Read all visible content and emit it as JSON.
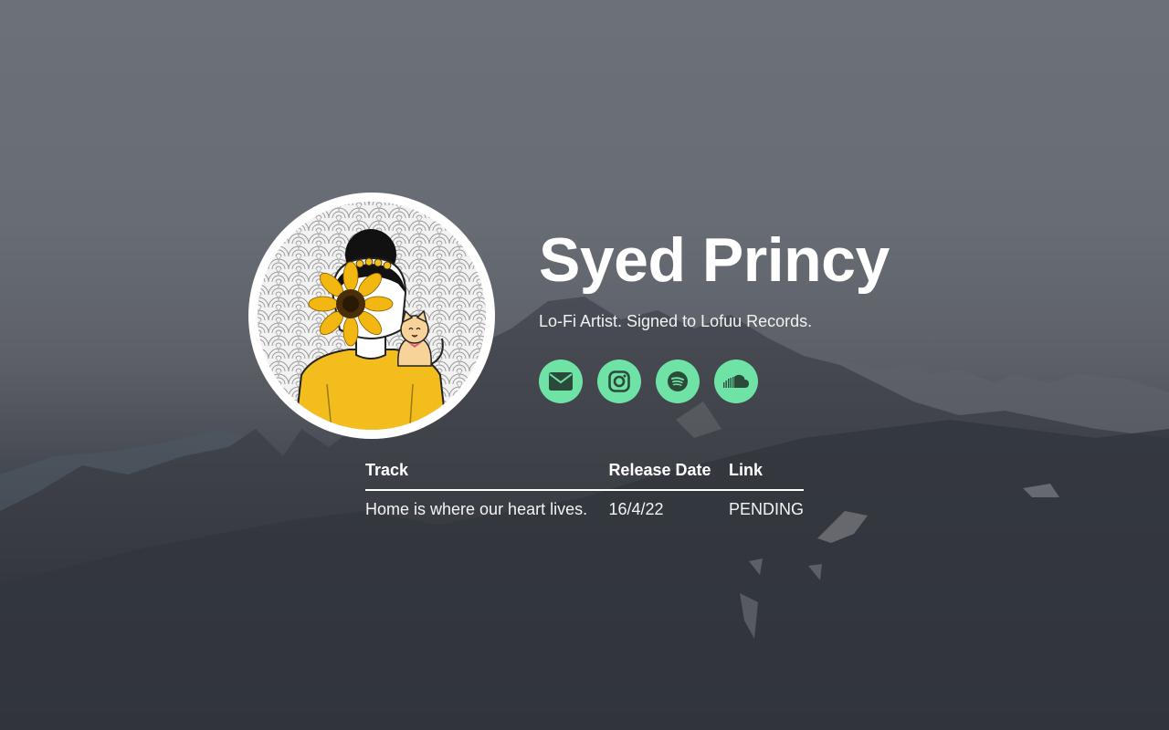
{
  "profile": {
    "name": "Syed Princy",
    "tagline": "Lo-Fi Artist. Signed to Lofuu Records.",
    "avatar_icon": "artist-avatar-sunflower-cat"
  },
  "socials": [
    {
      "icon": "envelope-icon",
      "label": "Email"
    },
    {
      "icon": "instagram-icon",
      "label": "Instagram"
    },
    {
      "icon": "spotify-icon",
      "label": "Spotify"
    },
    {
      "icon": "soundcloud-icon",
      "label": "SoundCloud"
    }
  ],
  "table": {
    "headers": {
      "track": "Track",
      "release_date": "Release Date",
      "link": "Link"
    },
    "rows": [
      {
        "track": "Home is where our heart lives.",
        "release_date": "16/4/22",
        "link": "PENDING"
      }
    ]
  },
  "colors": {
    "accent": "#6fe3a6",
    "icon_dark": "#2b4a39",
    "text": "#ffffff"
  }
}
